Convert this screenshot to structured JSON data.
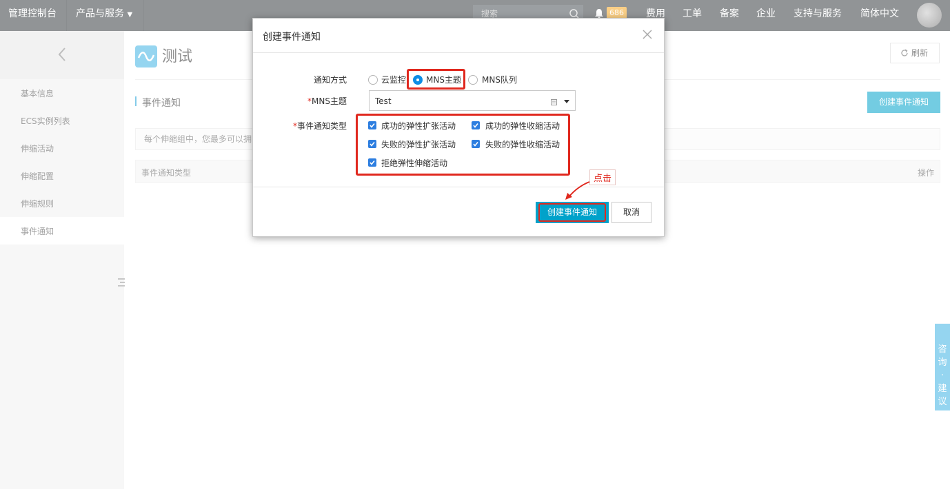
{
  "topbar": {
    "console": "管理控制台",
    "products": "产品与服务",
    "search_placeholder": "搜索",
    "notification_count": "686",
    "billing": "费用",
    "tickets": "工单",
    "icp": "备案",
    "enterprise": "企业",
    "support": "支持与服务",
    "language": "简体中文"
  },
  "sidebar": {
    "items": [
      {
        "label": "基本信息"
      },
      {
        "label": "ECS实例列表"
      },
      {
        "label": "伸缩活动"
      },
      {
        "label": "伸缩配置"
      },
      {
        "label": "伸缩规则"
      },
      {
        "label": "事件通知"
      }
    ],
    "active_index": 5
  },
  "main": {
    "page_title": "测试",
    "refresh_label": "刷新",
    "section_title": "事件通知",
    "create_button": "创建事件通知",
    "tip_text": "每个伸缩组中，您最多可以拥",
    "table_headers": {
      "type": "事件通知类型",
      "actions": "操作"
    }
  },
  "float_tab": {
    "label": "咨询·建议"
  },
  "modal": {
    "title": "创建事件通知",
    "notify_method_label": "通知方式",
    "notify_options": [
      {
        "label": "云监控",
        "selected": false
      },
      {
        "label": "MNS主题",
        "selected": true
      },
      {
        "label": "MNS队列",
        "selected": false
      }
    ],
    "mns_topic_label": "MNS主题",
    "mns_topic_value": "Test",
    "event_type_label": "事件通知类型",
    "event_types": [
      {
        "label": "成功的弹性扩张活动",
        "checked": true
      },
      {
        "label": "成功的弹性收缩活动",
        "checked": true
      },
      {
        "label": "失败的弹性扩张活动",
        "checked": true
      },
      {
        "label": "失败的弹性收缩活动",
        "checked": true
      },
      {
        "label": "拒绝弹性伸缩活动",
        "checked": true
      }
    ],
    "submit_label": "创建事件通知",
    "cancel_label": "取消"
  },
  "annotation": {
    "callout_text": "点击"
  },
  "colors": {
    "accent": "#00a2ca",
    "highlight": "#e0281e",
    "topbar": "#373d41",
    "radio_checkbox": "#2d7ee0"
  }
}
